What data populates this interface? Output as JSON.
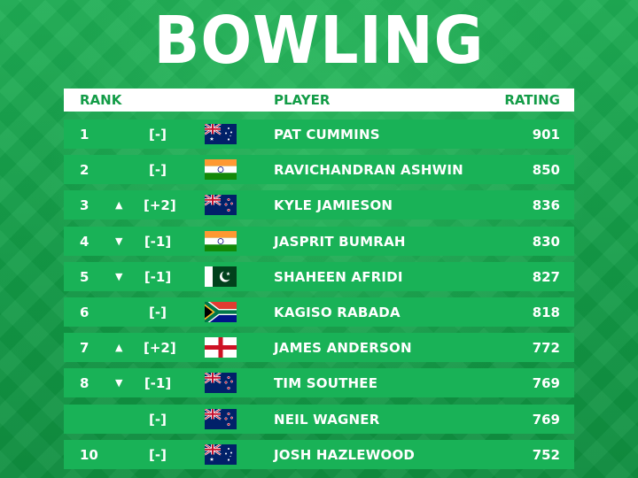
{
  "title": "BOWLING",
  "header": {
    "rank": "RANK",
    "player": "PLAYER",
    "rating": "RATING"
  },
  "rows": [
    {
      "rank": "1",
      "arrow": "",
      "change": "[-]",
      "flag": "australia-flag",
      "player": "PAT CUMMINS",
      "rating": "901"
    },
    {
      "rank": "2",
      "arrow": "",
      "change": "[-]",
      "flag": "india-flag",
      "player": "RAVICHANDRAN ASHWIN",
      "rating": "850"
    },
    {
      "rank": "3",
      "arrow": "▲",
      "change": "[+2]",
      "flag": "new-zealand-flag",
      "player": "KYLE JAMIESON",
      "rating": "836"
    },
    {
      "rank": "4",
      "arrow": "▼",
      "change": "[-1]",
      "flag": "india-flag",
      "player": "JASPRIT BUMRAH",
      "rating": "830"
    },
    {
      "rank": "5",
      "arrow": "▼",
      "change": "[-1]",
      "flag": "pakistan-flag",
      "player": "SHAHEEN AFRIDI",
      "rating": "827"
    },
    {
      "rank": "6",
      "arrow": "",
      "change": "[-]",
      "flag": "south-africa-flag",
      "player": "KAGISO RABADA",
      "rating": "818"
    },
    {
      "rank": "7",
      "arrow": "▲",
      "change": "[+2]",
      "flag": "england-flag",
      "player": "JAMES ANDERSON",
      "rating": "772"
    },
    {
      "rank": "8",
      "arrow": "▼",
      "change": "[-1]",
      "flag": "new-zealand-flag",
      "player": "TIM SOUTHEE",
      "rating": "769"
    },
    {
      "rank": "",
      "arrow": "",
      "change": "[-]",
      "flag": "new-zealand-flag",
      "player": "NEIL WAGNER",
      "rating": "769"
    },
    {
      "rank": "10",
      "arrow": "",
      "change": "[-]",
      "flag": "australia-flag",
      "player": "JOSH HAZLEWOOD",
      "rating": "752"
    }
  ]
}
